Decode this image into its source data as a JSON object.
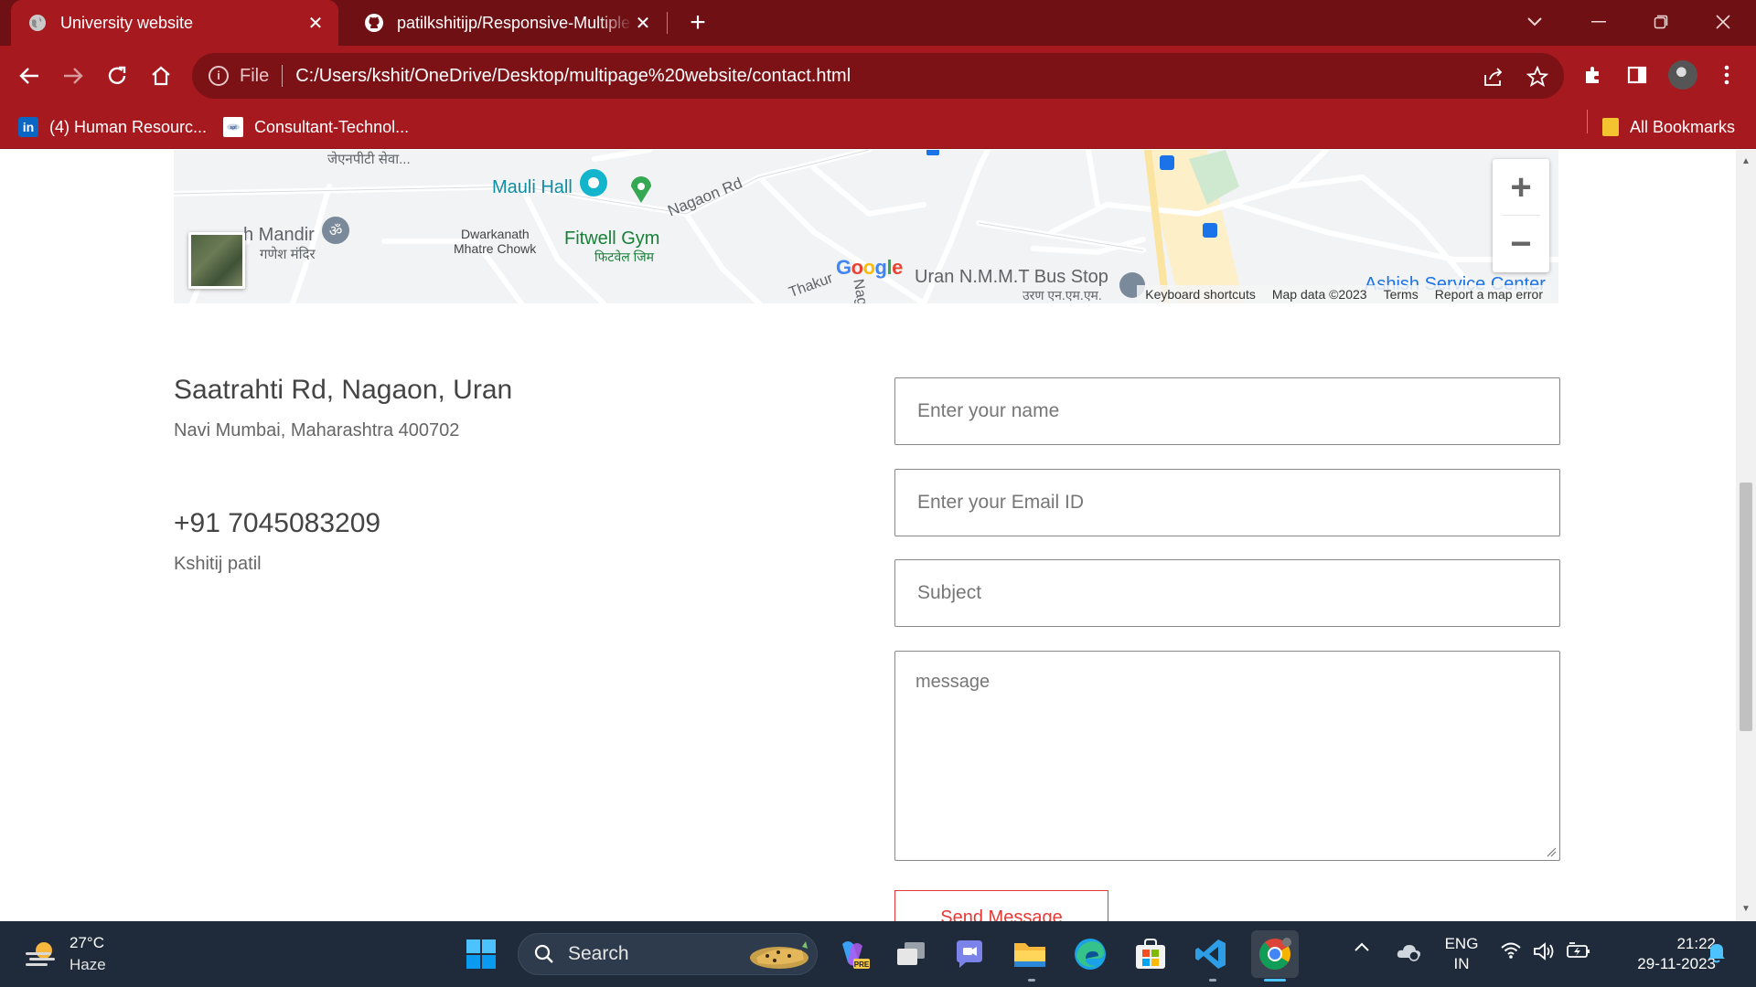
{
  "browser": {
    "tabs": [
      {
        "title": "University website",
        "active": true
      },
      {
        "title": "patilkshitijp/Responsive-Multiple",
        "active": false
      }
    ],
    "address": {
      "scheme_label": "File",
      "url": "C:/Users/kshit/OneDrive/Desktop/multipage%20website/contact.html"
    },
    "bookmarks": [
      {
        "label": "(4) Human Resourc...",
        "icon": "linkedin-icon"
      },
      {
        "label": "Consultant-Technol...",
        "icon": "site-icon"
      }
    ],
    "all_bookmarks_label": "All Bookmarks",
    "theme_color": "#a6191e"
  },
  "map": {
    "labels": {
      "top_devanagari": "जेएनपीटी सेवा...",
      "mauli_hall": "Mauli Hall",
      "nagaon_rd": "Nagaon Rd",
      "mandir": "h Mandir",
      "mandir_devanagari": "गणेश मंदिर",
      "dwarkanath": "Dwarkanath",
      "mhatre_chowk": "Mhatre Chowk",
      "fitwell_gym": "Fitwell Gym",
      "fitwell_devanagari": "फिटवेल जिम",
      "thakur": "Thakur",
      "nagar": "Nagar R",
      "bus_stop": "Uran N.M.M.T Bus Stop",
      "bus_stop_devanagari": "उरण एन.एम.एम.",
      "service_center": "Ashish Service Center"
    },
    "google": "Google",
    "footer": {
      "shortcuts": "Keyboard shortcuts",
      "map_data": "Map data ©2023",
      "terms": "Terms",
      "report": "Report a map error"
    },
    "zoom_in": "+",
    "zoom_out": "−"
  },
  "contact": {
    "address_line1": "Saatrahti Rd, Nagaon, Uran",
    "address_line2": "Navi Mumbai, Maharashtra 400702",
    "phone": "+91 7045083209",
    "name": "Kshitij patil"
  },
  "form": {
    "name_placeholder": "Enter your name",
    "email_placeholder": "Enter your Email ID",
    "subject_placeholder": "Subject",
    "message_placeholder": "message",
    "send_label": "Send Message",
    "accent_color": "#e53935"
  },
  "taskbar": {
    "weather": {
      "temp": "27°C",
      "desc": "Haze"
    },
    "search_label": "Search",
    "lang": [
      "ENG",
      "IN"
    ],
    "time": "21:22",
    "date": "29-11-2023",
    "apps": [
      "windows-start",
      "copilot",
      "task-view",
      "teams-chat",
      "file-explorer",
      "edge",
      "microsoft-store",
      "vscode",
      "chrome"
    ]
  }
}
